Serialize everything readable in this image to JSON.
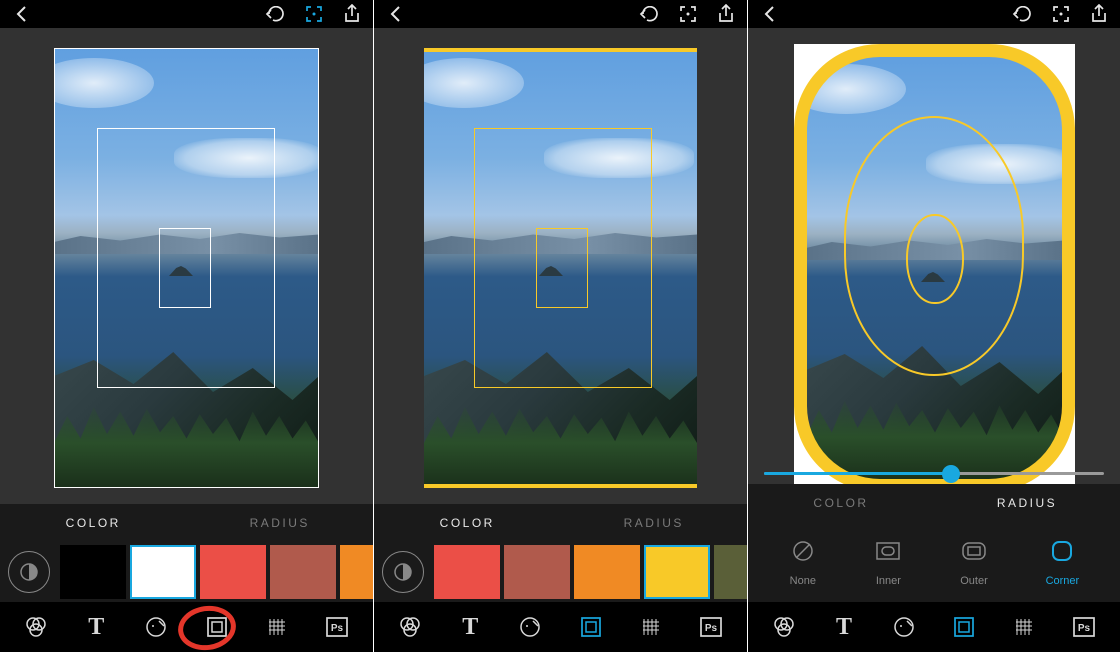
{
  "screens": [
    {
      "tabs": {
        "color": "COLOR",
        "radius": "RADIUS",
        "active": "color"
      },
      "swatches": [
        "#000000",
        "#ffffff",
        "#eb4f47",
        "#b05a4c",
        "#f08a24"
      ],
      "selectedSwatch": 1,
      "frameStyle": "white-sharp",
      "annotated": true
    },
    {
      "tabs": {
        "color": "COLOR",
        "radius": "RADIUS",
        "active": "color"
      },
      "swatches": [
        "#eb4f47",
        "#b05a4c",
        "#f08a24",
        "#f8c928",
        "#5a5f38"
      ],
      "selectedSwatch": 3,
      "frameStyle": "yellow-sharp"
    },
    {
      "tabs": {
        "color": "COLOR",
        "radius": "RADIUS",
        "active": "radius"
      },
      "radiusOptions": [
        {
          "key": "none",
          "label": "None"
        },
        {
          "key": "inner",
          "label": "Inner"
        },
        {
          "key": "outer",
          "label": "Outer"
        },
        {
          "key": "corner",
          "label": "Corner"
        }
      ],
      "selectedRadius": "corner",
      "sliderValue": 55,
      "frameStyle": "yellow-round"
    }
  ],
  "tools": [
    "filters",
    "text",
    "stickers",
    "frames",
    "texture",
    "photoshop"
  ],
  "activeTool": "frames"
}
